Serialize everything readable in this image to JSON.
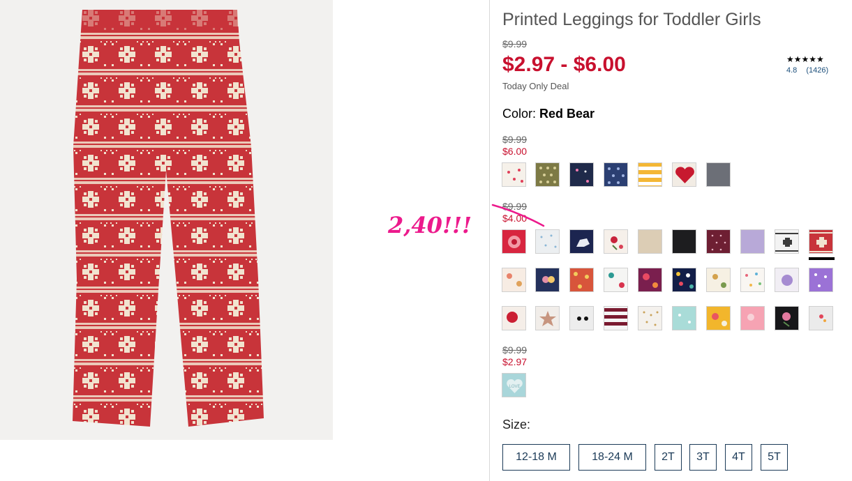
{
  "product": {
    "title": "Printed Leggings for Toddler Girls",
    "original_price": "$9.99",
    "sale_price_range": "$2.97 - $6.00",
    "deal_text": "Today Only Deal"
  },
  "rating": {
    "stars": "★★★★★",
    "value": "4.8",
    "count": "(1426)"
  },
  "color": {
    "label": "Color:",
    "selected": "Red Bear"
  },
  "price_groups": [
    {
      "old": "$9.99",
      "new": "$6.00"
    },
    {
      "old": "$9.99",
      "new": "$4.00"
    },
    {
      "old": "$9.99",
      "new": "$2.97"
    }
  ],
  "annotation": {
    "text": "2,40!!!",
    "color": "#ec1a8c"
  },
  "size": {
    "label": "Size:",
    "options": [
      "12-18 M",
      "18-24 M",
      "2T",
      "3T",
      "4T",
      "5T"
    ]
  },
  "colors": {
    "accent_red": "#c8102e",
    "size_border": "#1b3a57",
    "legging_red": "#c8343a",
    "legging_cream": "#f1e3cf"
  }
}
